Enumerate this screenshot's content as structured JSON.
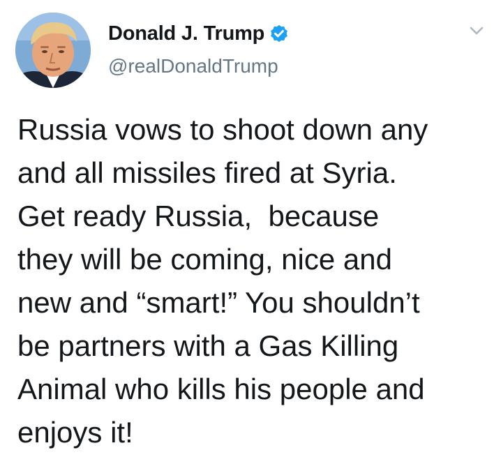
{
  "author": {
    "display_name": "Donald J. Trump",
    "handle": "@realDonaldTrump",
    "verified": true,
    "verified_color": "#1da1f2"
  },
  "icons": {
    "avatar": "profile-photo",
    "verified": "verified-badge-icon",
    "menu": "chevron-down-icon"
  },
  "tweet": {
    "lines": [
      "Russia vows to shoot down any",
      "and all missiles fired at Syria.",
      "Get ready Russia,  because",
      "they will be coming, nice and",
      "new and “smart!” You shouldn’t",
      "be partners with a Gas Killing",
      "Animal who kills his people and",
      "enjoys it!"
    ]
  },
  "colors": {
    "text": "#14171a",
    "secondary": "#657786",
    "caret": "#aab8c2"
  }
}
